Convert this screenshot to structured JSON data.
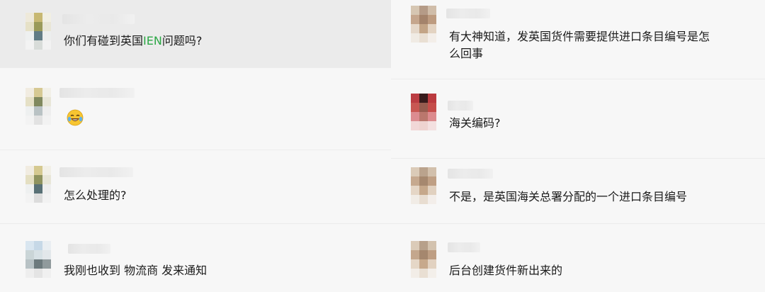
{
  "left": [
    {
      "text_a": "你们有碰到英国",
      "highlight": "IEN",
      "text_b": "问题吗?"
    },
    {
      "emoji": "laugh-cry-emoji"
    },
    {
      "text": "怎么处理的?"
    },
    {
      "text": "我刚也收到 物流商 发来通知"
    }
  ],
  "right": [
    {
      "line1": "有大神知道，发英国货件需要提供进口条目编号是怎",
      "line2": "么回事"
    },
    {
      "text": "海关编码?"
    },
    {
      "text": "不是，是英国海关总署分配的一个进口条目编号"
    },
    {
      "text": "后台创建货件新出来的"
    }
  ],
  "colors": {
    "highlight": "#2aa744",
    "selected_bg": "#ebebeb",
    "bg": "#f7f7f7"
  }
}
